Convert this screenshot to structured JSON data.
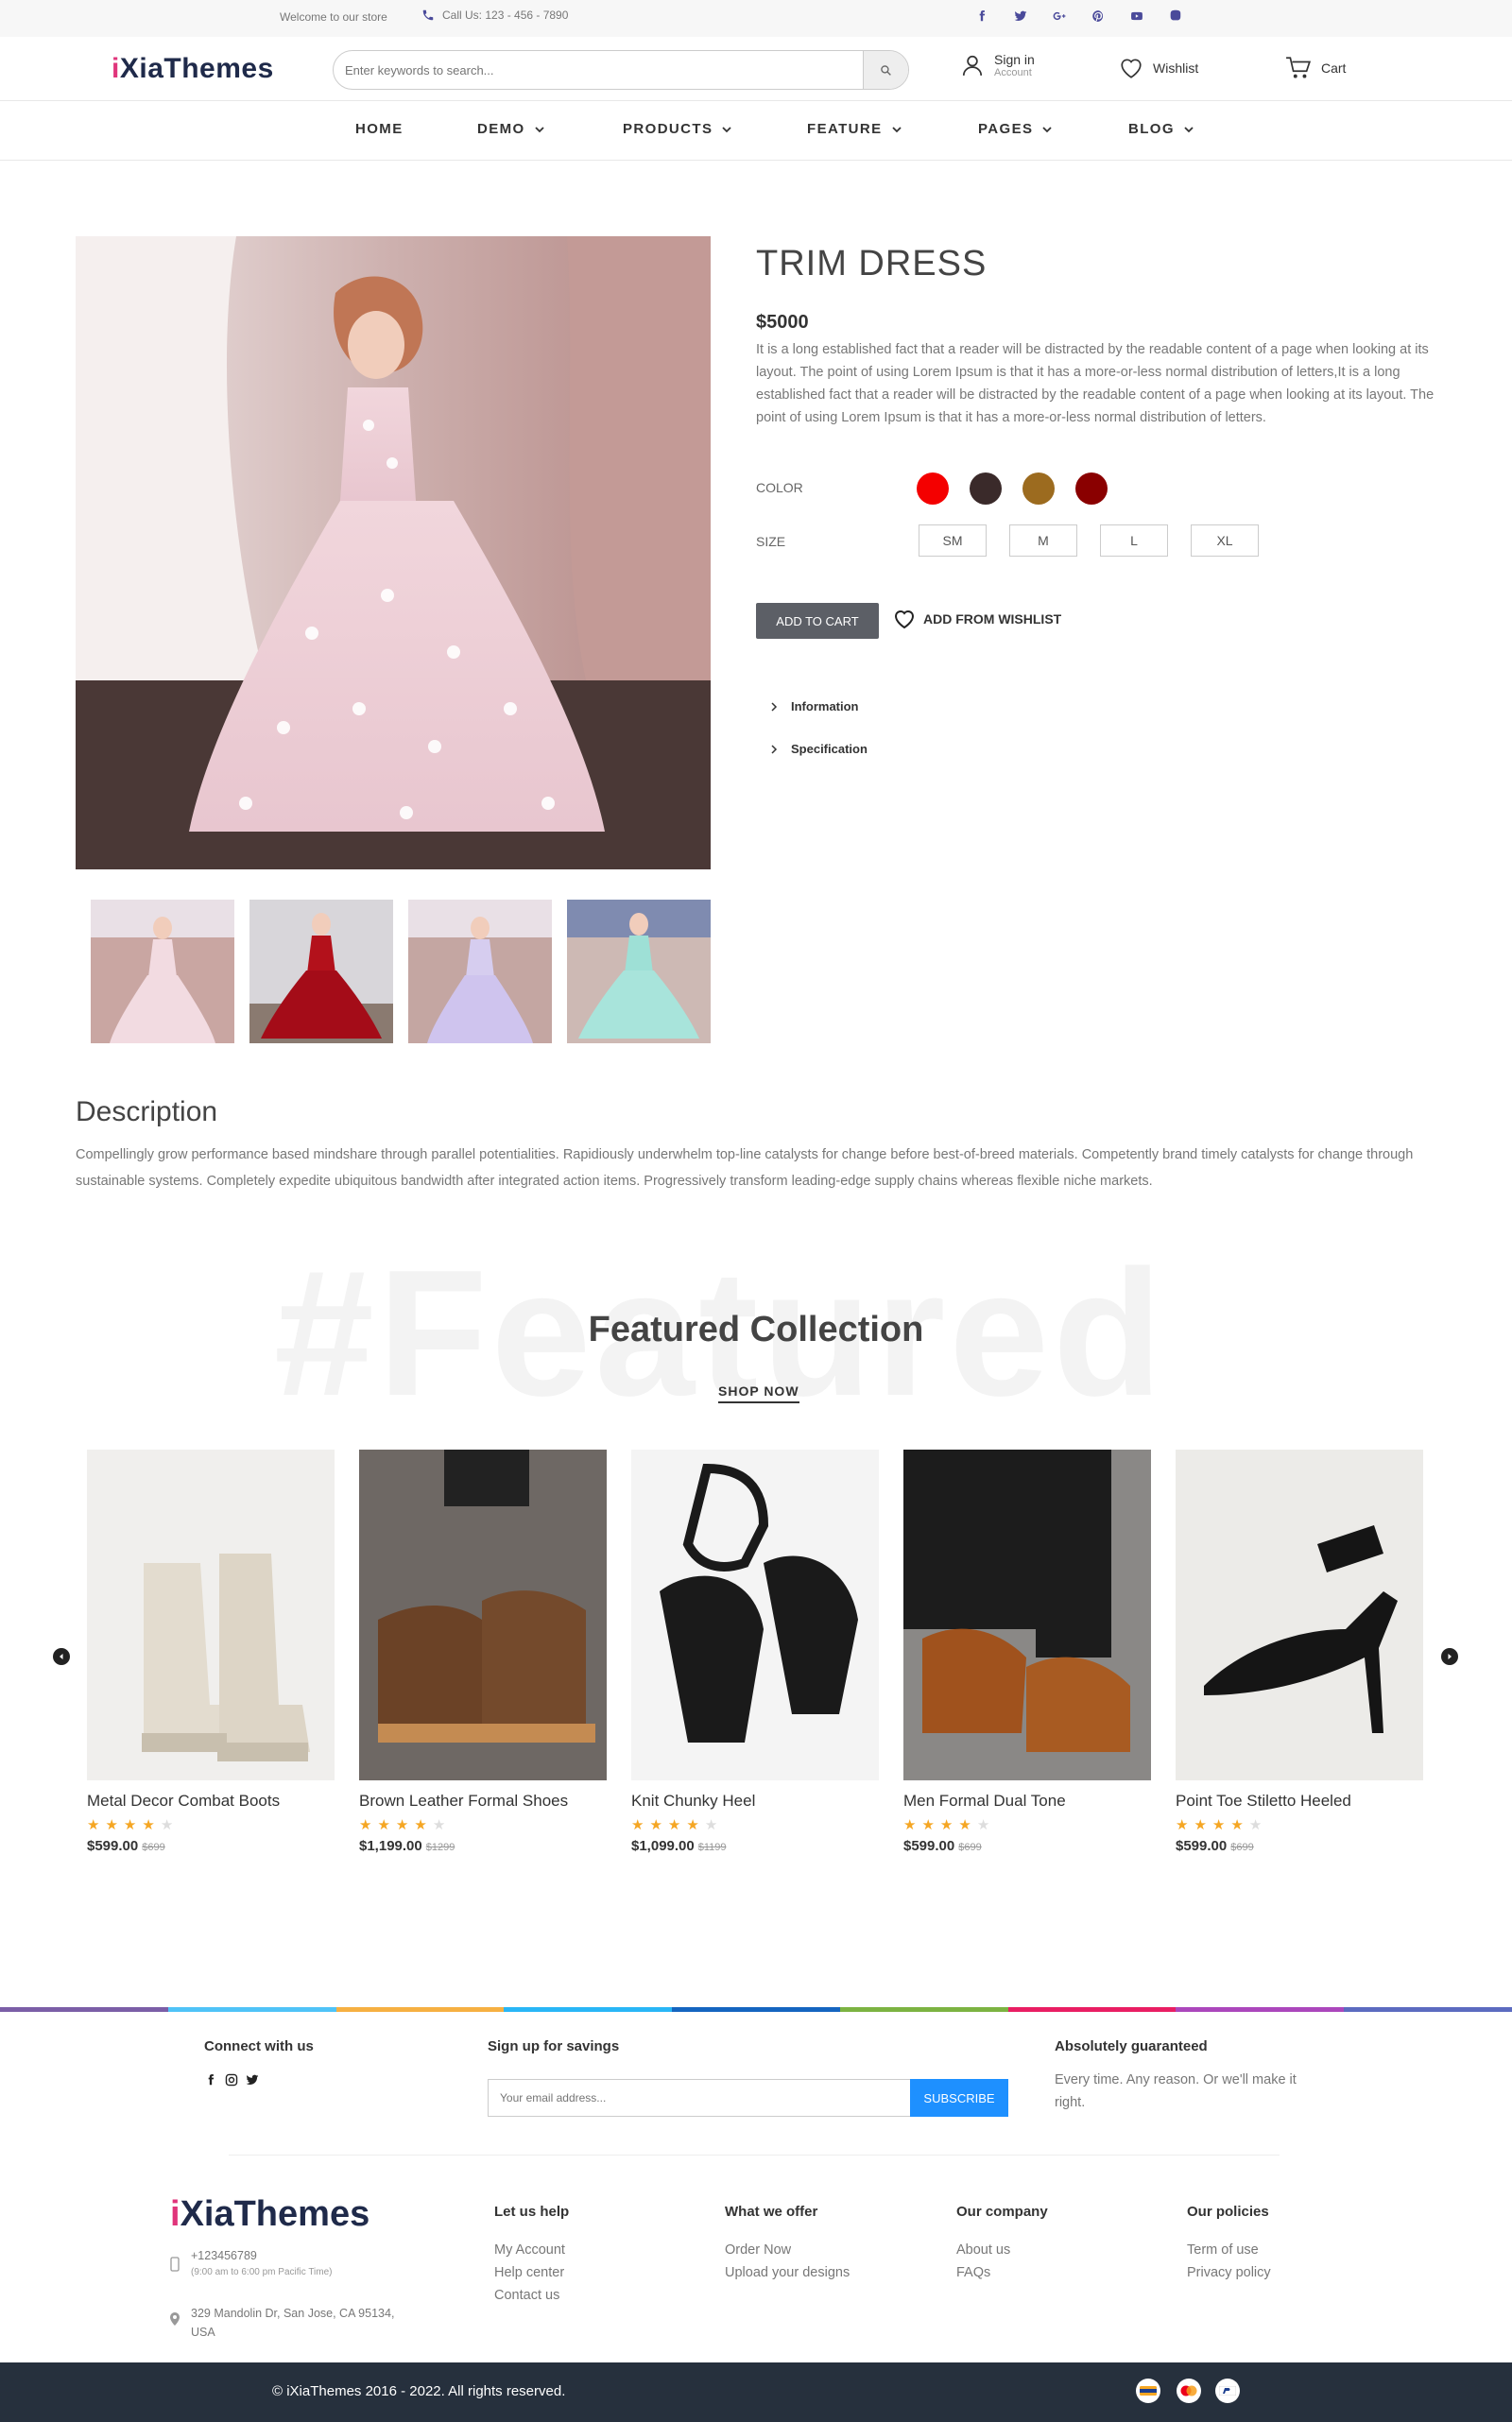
{
  "topbar": {
    "welcome": "Welcome to our store",
    "call": "Call Us: 123 - 456 - 7890",
    "social_icons": [
      "facebook-icon",
      "twitter-icon",
      "google-plus-icon",
      "pinterest-icon",
      "youtube-icon",
      "instagram-icon"
    ]
  },
  "header": {
    "logo_prefix": "i",
    "logo_rest": "XiaThemes",
    "search_placeholder": "Enter keywords to search...",
    "signin_label": "Sign in",
    "signin_sub": "Account",
    "wishlist_label": "Wishlist",
    "cart_label": "Cart"
  },
  "nav": {
    "items": [
      {
        "label": "HOME",
        "dropdown": false
      },
      {
        "label": "DEMO",
        "dropdown": true
      },
      {
        "label": "PRODUCTS",
        "dropdown": true
      },
      {
        "label": "FEATURE",
        "dropdown": true
      },
      {
        "label": "PAGES",
        "dropdown": true
      },
      {
        "label": "BLOG",
        "dropdown": true
      }
    ]
  },
  "product": {
    "title": "TRIM DRESS",
    "price": "$5000",
    "description": "It is a long established fact that a reader will be distracted by the readable content of a page when looking at its layout. The point of using Lorem Ipsum is that it has a more-or-less normal distribution of letters,It is a long established fact that a reader will be distracted by the readable content of a page when looking at its layout. The point of using Lorem Ipsum is that it has a more-or-less normal distribution of letters.",
    "color_label": "COLOR",
    "colors": [
      "#f40000",
      "#3a2a2a",
      "#9c6b1f",
      "#8a0000"
    ],
    "size_label": "SIZE",
    "sizes": [
      "SM",
      "M",
      "L",
      "XL"
    ],
    "add_to_cart": "ADD TO CART",
    "add_wishlist": "ADD FROM WISHLIST",
    "accordion": [
      "Information",
      "Specification"
    ]
  },
  "description": {
    "heading": "Description",
    "text": "Compellingly grow performance based mindshare through parallel potentialities. Rapidiously underwhelm top-line catalysts for change before best-of-breed materials. Competently brand timely catalysts for change through sustainable systems. Completely expedite ubiquitous bandwidth after integrated action items. Progressively transform leading-edge supply chains whereas flexible niche markets."
  },
  "featured": {
    "background_text": "#Featured",
    "heading": "Featured Collection",
    "shop_now": "SHOP NOW",
    "products": [
      {
        "name": "Metal Decor Combat Boots",
        "price": "$599.00",
        "old_price": "$699",
        "rating": 4
      },
      {
        "name": "Brown Leather Formal Shoes",
        "price": "$1,199.00",
        "old_price": "$1299",
        "rating": 4
      },
      {
        "name": "Knit Chunky Heel",
        "price": "$1,099.00",
        "old_price": "$1199",
        "rating": 4
      },
      {
        "name": "Men Formal Dual Tone",
        "price": "$599.00",
        "old_price": "$699",
        "rating": 4
      },
      {
        "name": "Point Toe Stiletto Heeled",
        "price": "$599.00",
        "old_price": "$699",
        "rating": 4
      }
    ]
  },
  "footer": {
    "connect_heading": "Connect with us",
    "signup_heading": "Sign up for savings",
    "email_placeholder": "Your email address...",
    "subscribe": "SUBSCRIBE",
    "guarantee_heading": "Absolutely guaranteed",
    "guarantee_text": "Every time. Any reason. Or we'll make it right.",
    "logo_prefix": "i",
    "logo_rest": "XiaThemes",
    "phone": "+123456789",
    "hours": "(9:00 am to 6:00 pm Pacific Time)",
    "address": "329 Mandolin Dr, San Jose, CA 95134, USA",
    "columns": [
      {
        "heading": "Let us help",
        "links": [
          "My Account",
          "Help center",
          "Contact us"
        ]
      },
      {
        "heading": "What we offer",
        "links": [
          "Order Now",
          "Upload your designs"
        ]
      },
      {
        "heading": "Our company",
        "links": [
          "About us",
          "FAQs"
        ]
      },
      {
        "heading": "Our policies",
        "links": [
          "Term of use",
          "Privacy policy"
        ]
      }
    ],
    "copyright": "© iXiaThemes 2016 - 2022. All rights reserved.",
    "rainbow_colors": [
      "#7b5ea7",
      "#4fc3f7",
      "#f6b042",
      "#29b6f6",
      "#1565c0",
      "#7cb342",
      "#e91e63",
      "#ab47bc",
      "#5c6bc0"
    ]
  }
}
